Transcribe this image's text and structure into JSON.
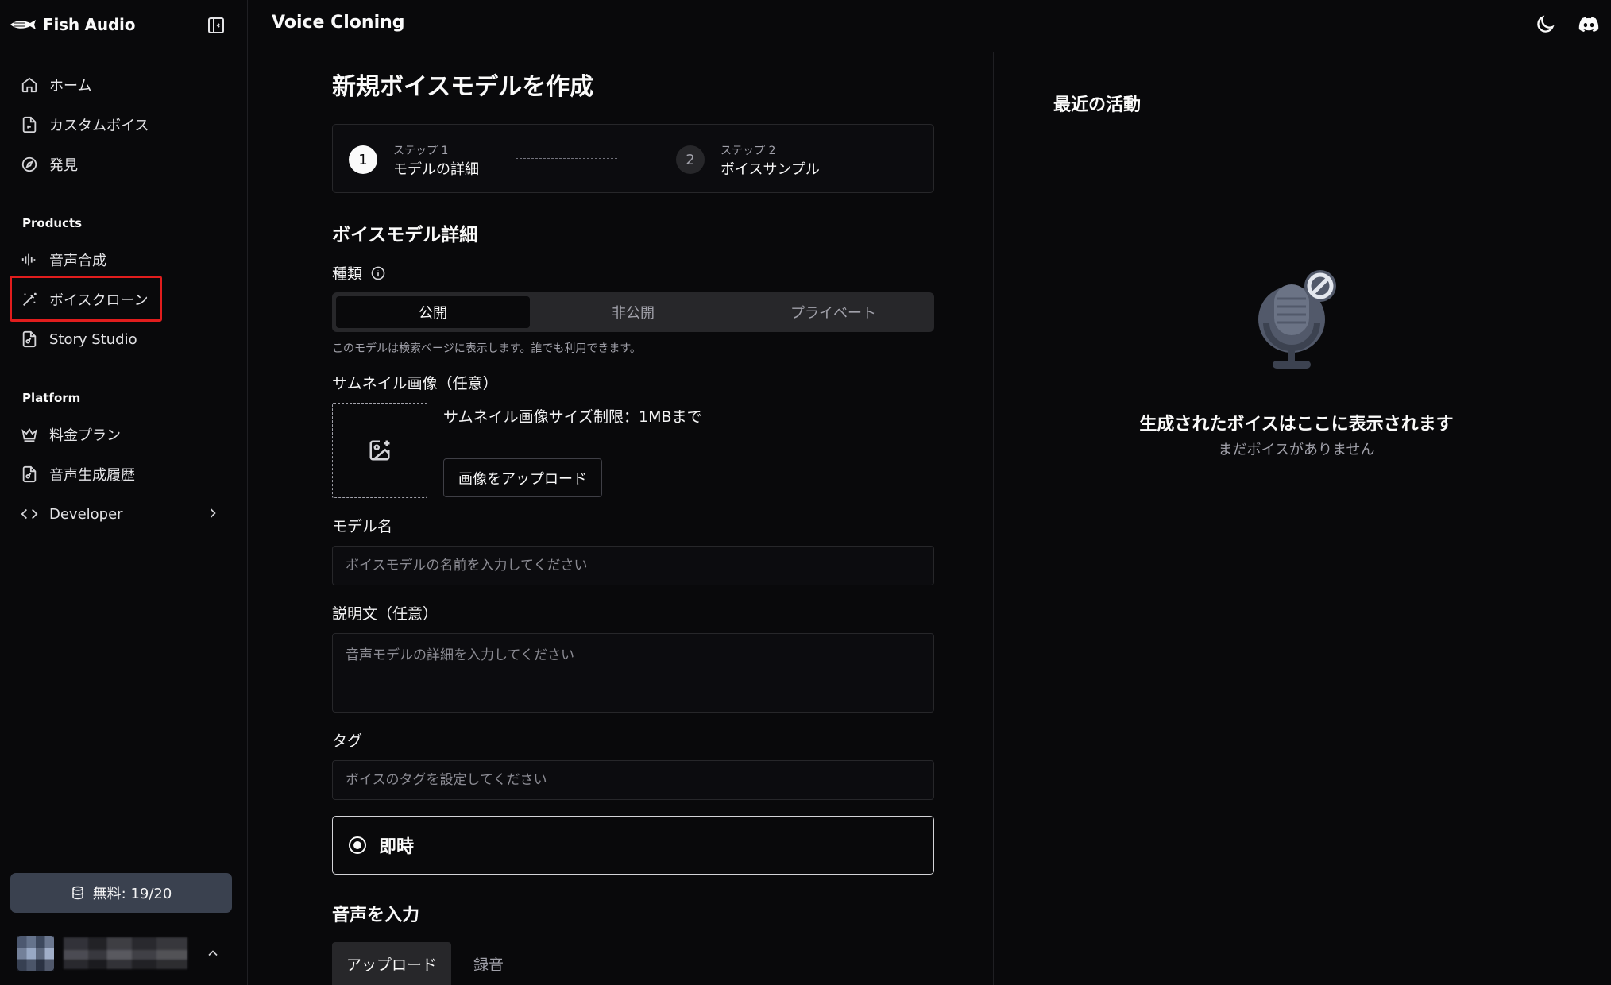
{
  "brand": {
    "name": "Fish Audio"
  },
  "header": {
    "title": "Voice Cloning"
  },
  "sidebar": {
    "items": [
      {
        "label": "ホーム",
        "icon": "home-icon"
      },
      {
        "label": "カスタムボイス",
        "icon": "file-audio-icon"
      },
      {
        "label": "発見",
        "icon": "compass-icon"
      }
    ],
    "products_label": "Products",
    "products": [
      {
        "label": "音声合成",
        "icon": "audio-lines-icon"
      },
      {
        "label": "ボイスクローン",
        "icon": "magic-wand-icon",
        "active": true
      },
      {
        "label": "Story Studio",
        "icon": "book-audio-icon"
      }
    ],
    "platform_label": "Platform",
    "platform": [
      {
        "label": "料金プラン",
        "icon": "crown-icon"
      },
      {
        "label": "音声生成履歴",
        "icon": "history-icon"
      },
      {
        "label": "Developer",
        "icon": "code-icon"
      }
    ],
    "credit_label": "無料: 19/20"
  },
  "form": {
    "title": "新規ボイスモデルを作成",
    "steps": [
      {
        "number": "1",
        "caption": "ステップ 1",
        "label": "モデルの詳細"
      },
      {
        "number": "2",
        "caption": "ステップ 2",
        "label": "ボイスサンプル"
      }
    ],
    "details_heading": "ボイスモデル詳細",
    "visibility_label": "種類",
    "visibility_options": [
      "公開",
      "非公開",
      "プライベート"
    ],
    "visibility_selected": "公開",
    "visibility_hint": "このモデルは検索ページに表示します。誰でも利用できます。",
    "thumbnail_label": "サムネイル画像（任意）",
    "thumbnail_limit": "サムネイル画像サイズ制限：1MBまで",
    "upload_image_button": "画像をアップロード",
    "model_name_label": "モデル名",
    "model_name_placeholder": "ボイスモデルの名前を入力してください",
    "description_label": "説明文（任意）",
    "description_placeholder": "音声モデルの詳細を入力してください",
    "tags_label": "タグ",
    "tags_placeholder": "ボイスのタグを設定してください",
    "mode_option": "即時",
    "audio_heading": "音声を入力",
    "audio_tabs": [
      "アップロード",
      "録音"
    ]
  },
  "activity": {
    "title": "最近の活動",
    "empty_title": "生成されたボイスはここに表示されます",
    "empty_subtitle": "まだボイスがありません"
  },
  "colors": {
    "background": "#09090b",
    "highlight": "#e11d1d",
    "credit_button": "#3a414f"
  }
}
